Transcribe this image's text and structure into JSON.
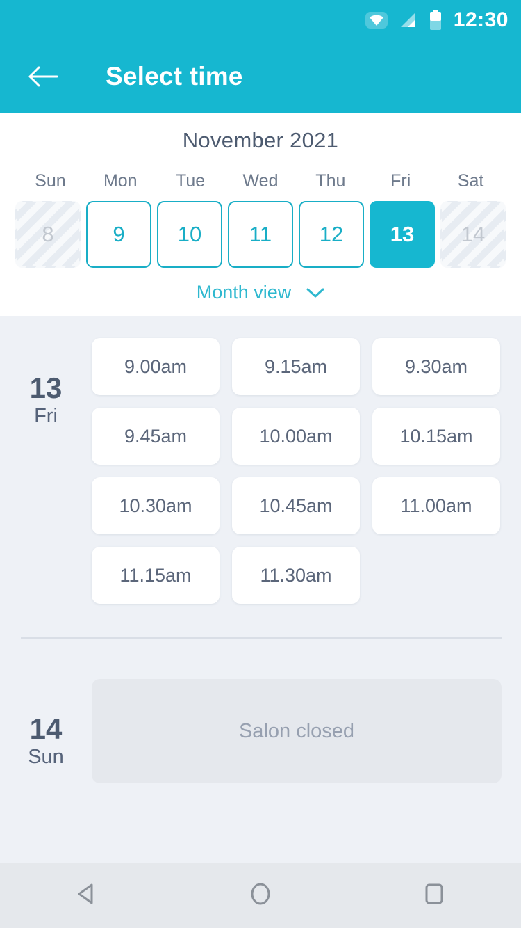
{
  "status_bar": {
    "time": "12:30",
    "icons": [
      "wifi-icon",
      "signal-icon",
      "battery-icon"
    ]
  },
  "app_bar": {
    "back_icon": "arrow-left-icon",
    "title": "Select time"
  },
  "calendar": {
    "month_title": "November 2021",
    "weekdays": [
      "Sun",
      "Mon",
      "Tue",
      "Wed",
      "Thu",
      "Fri",
      "Sat"
    ],
    "days": [
      {
        "label": "8",
        "state": "disabled"
      },
      {
        "label": "9",
        "state": "available"
      },
      {
        "label": "10",
        "state": "available"
      },
      {
        "label": "11",
        "state": "available"
      },
      {
        "label": "12",
        "state": "available"
      },
      {
        "label": "13",
        "state": "selected"
      },
      {
        "label": "14",
        "state": "disabled"
      }
    ],
    "view_toggle": {
      "label": "Month view",
      "icon": "chevron-down-icon"
    }
  },
  "schedule": {
    "day_groups": [
      {
        "day_number": "13",
        "day_name": "Fri",
        "slots": [
          "9.00am",
          "9.15am",
          "9.30am",
          "9.45am",
          "10.00am",
          "10.15am",
          "10.30am",
          "10.45am",
          "11.00am",
          "11.15am",
          "11.30am"
        ]
      },
      {
        "day_number": "14",
        "day_name": "Sun",
        "closed_message": "Salon closed"
      }
    ]
  },
  "nav_bar": {
    "back": "nav-back-icon",
    "home": "nav-home-icon",
    "recents": "nav-recents-icon"
  },
  "colors": {
    "accent": "#16b7d0",
    "accent_border": "#19aec6",
    "page_background": "#eef1f6",
    "text_dark": "#4d5b70",
    "text_muted": "#6e7a8c",
    "closed_panel": "#e5e8ed"
  }
}
